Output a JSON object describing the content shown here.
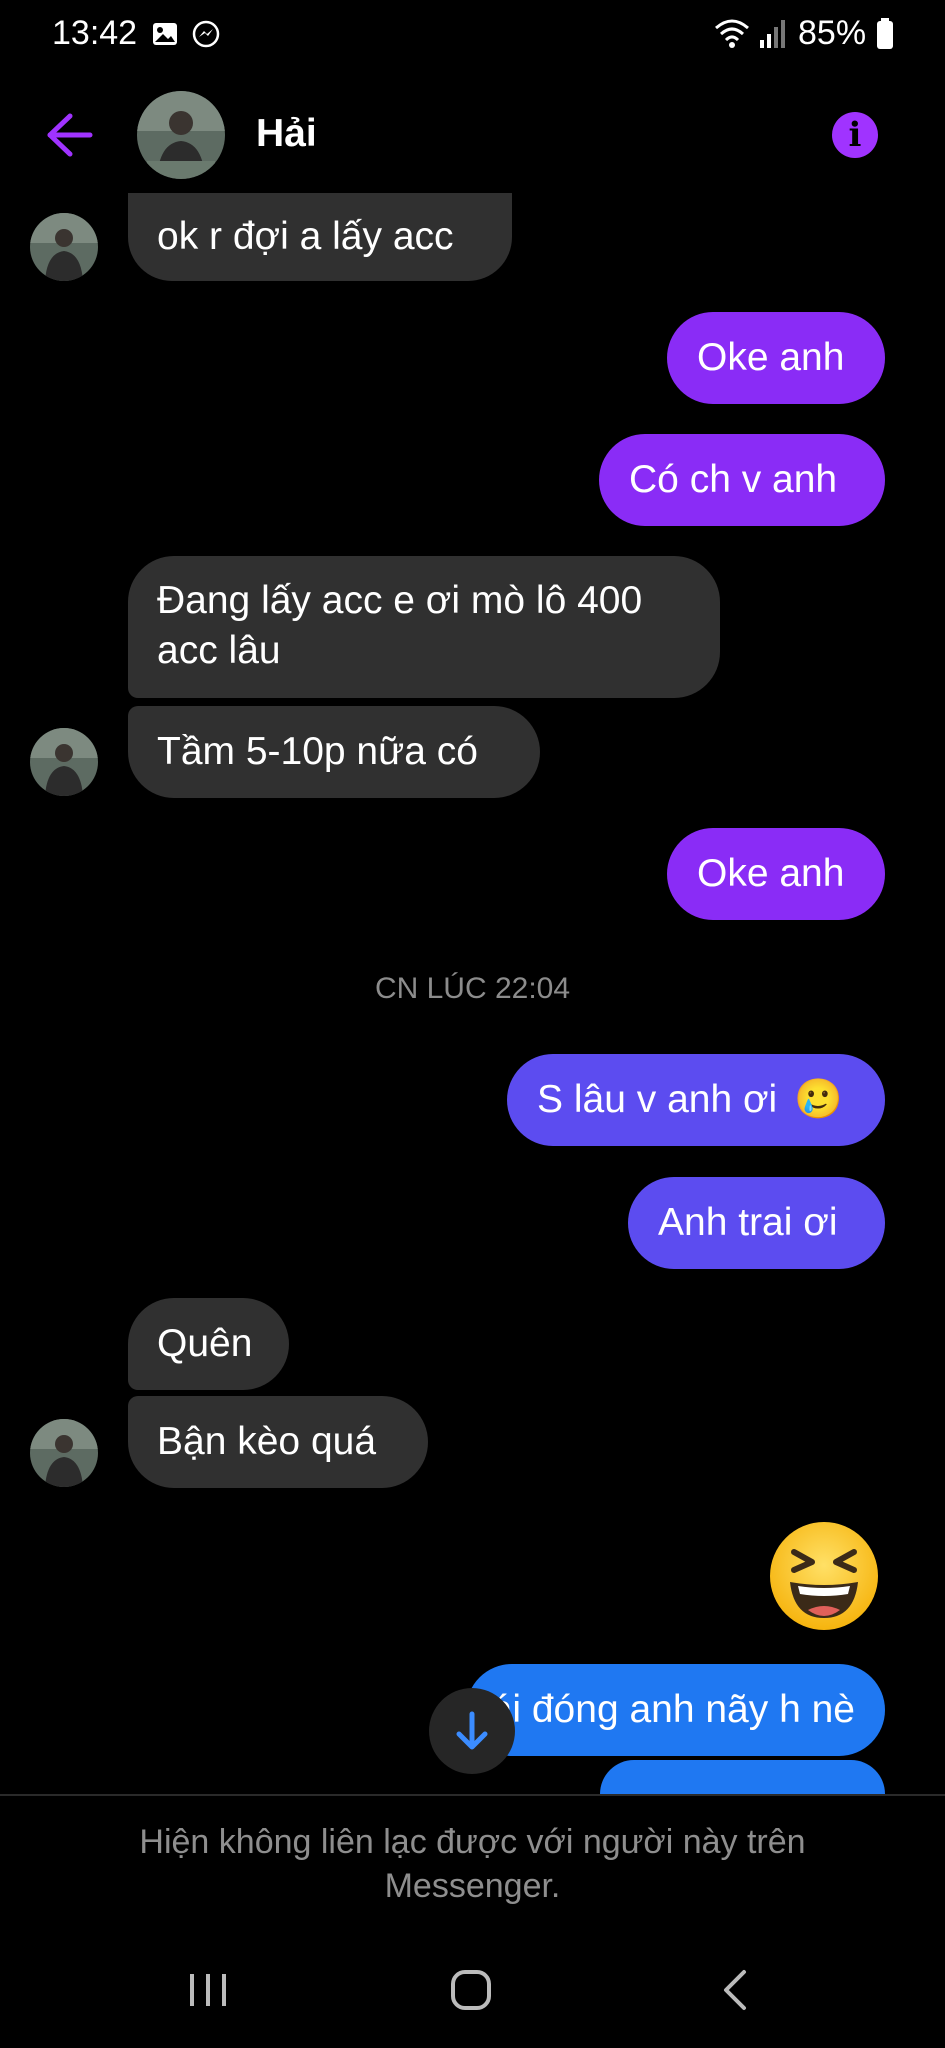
{
  "status_bar": {
    "time": "13:42",
    "battery": "85%",
    "icons": [
      "gallery-icon",
      "messenger-icon",
      "wifi-icon",
      "signal-icon",
      "battery-icon"
    ]
  },
  "header": {
    "contact_name": "Hải",
    "back_icon": "arrow-left-icon",
    "info_icon": "info-icon",
    "info_glyph": "i"
  },
  "messages": [
    {
      "side": "in",
      "text": "ok r đợi a lấy acc"
    },
    {
      "side": "out",
      "text": "Oke anh"
    },
    {
      "side": "out",
      "text": "Có ch v anh"
    },
    {
      "side": "in",
      "line1": "Đang lấy acc e ơi mò lô 400",
      "line2": "acc lâu"
    },
    {
      "side": "in",
      "text": "Tầm 5-10p nữa có"
    },
    {
      "side": "out",
      "text": "Oke anh"
    },
    {
      "side": "out",
      "text": "S lâu v anh ơi",
      "emoji": "🥲"
    },
    {
      "side": "out",
      "text": "Anh trai ơi"
    },
    {
      "side": "in",
      "text": "Quên"
    },
    {
      "side": "in",
      "text": "Bận kèo quá"
    },
    {
      "side": "out",
      "emoji": "😆"
    },
    {
      "side": "out",
      "text": "Ưng cái đóng anh nãy h nè"
    }
  ],
  "timestamp": "CN LÚC 22:04",
  "footer": {
    "line1": "Hiện không liên lạc được với người này trên",
    "line2": "Messenger."
  },
  "colors": {
    "accent": "#a033ff",
    "bubble_in": "#303030",
    "bubble_out_purple": "#8a2cf6",
    "bubble_out_indigo": "#5c4cf0",
    "bubble_out_blue": "#1f78f2"
  }
}
